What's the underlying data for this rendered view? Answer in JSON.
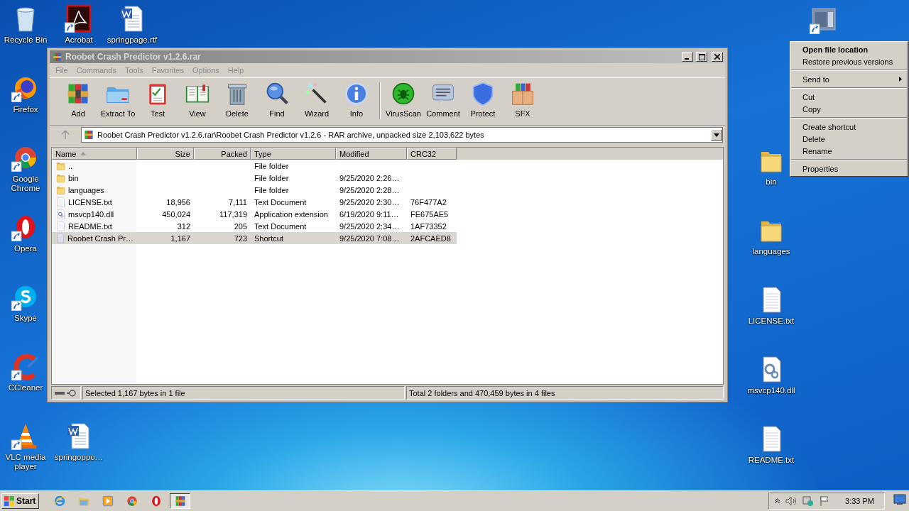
{
  "desktop_icons": [
    {
      "label": "Recycle Bin",
      "kind": "recycle",
      "shortcut": false
    },
    {
      "label": "Firefox",
      "kind": "firefox",
      "shortcut": true
    },
    {
      "label": "Google Chrome",
      "kind": "chrome",
      "shortcut": true
    },
    {
      "label": "Opera",
      "kind": "opera",
      "shortcut": true
    },
    {
      "label": "Skype",
      "kind": "skype",
      "shortcut": true
    },
    {
      "label": "CCleaner",
      "kind": "ccleaner",
      "shortcut": true
    },
    {
      "label": "VLC media player",
      "kind": "vlc",
      "shortcut": true
    },
    {
      "label": "Acrobat",
      "kind": "acrobat",
      "shortcut": true
    },
    {
      "label": "springpage.rtf",
      "kind": "word",
      "shortcut": false
    },
    {
      "label": "springoppo…",
      "kind": "word",
      "shortcut": false
    },
    {
      "kind": "appwindow",
      "shortcut": true
    },
    {
      "label": "bin",
      "kind": "folder",
      "shortcut": false
    },
    {
      "label": "languages",
      "kind": "folder",
      "shortcut": false
    },
    {
      "label": "LICENSE.txt",
      "kind": "text",
      "shortcut": false
    },
    {
      "label": "msvcp140.dll",
      "kind": "dll",
      "shortcut": false
    },
    {
      "label": "README.txt",
      "kind": "text",
      "shortcut": false
    }
  ],
  "window": {
    "title": "Roobet Crash Predictor v1.2.6.rar",
    "menu": [
      "File",
      "Commands",
      "Tools",
      "Favorites",
      "Options",
      "Help"
    ],
    "toolbar_groups": [
      [
        {
          "label": "Add",
          "kind": "add"
        },
        {
          "label": "Extract To",
          "kind": "extract"
        },
        {
          "label": "Test",
          "kind": "test"
        },
        {
          "label": "View",
          "kind": "view"
        },
        {
          "label": "Delete",
          "kind": "delete"
        },
        {
          "label": "Find",
          "kind": "find"
        },
        {
          "label": "Wizard",
          "kind": "wizard"
        },
        {
          "label": "Info",
          "kind": "info"
        }
      ],
      [
        {
          "label": "VirusScan",
          "kind": "virus"
        },
        {
          "label": "Comment",
          "kind": "comment"
        },
        {
          "label": "Protect",
          "kind": "protect"
        },
        {
          "label": "SFX",
          "kind": "sfx"
        }
      ]
    ],
    "address": "Roobet Crash Predictor v1.2.6.rar\\Roobet Crash Predictor v1.2.6 - RAR archive, unpacked size 2,103,622 bytes",
    "columns": [
      "Name",
      "Size",
      "Packed",
      "Type",
      "Modified",
      "CRC32"
    ],
    "files": [
      {
        "name": "..",
        "type": "File folder",
        "kind": "folder",
        "selected": false
      },
      {
        "name": "bin",
        "type": "File folder",
        "modified": "9/25/2020 2:26…",
        "kind": "folder",
        "selected": false
      },
      {
        "name": "languages",
        "type": "File folder",
        "modified": "9/25/2020 2:28…",
        "kind": "folder",
        "selected": false
      },
      {
        "name": "LICENSE.txt",
        "size": "18,956",
        "packed": "7,111",
        "type": "Text Document",
        "modified": "9/25/2020 2:30…",
        "crc32": "76F477A2",
        "kind": "text",
        "selected": false
      },
      {
        "name": "msvcp140.dll",
        "size": "450,024",
        "packed": "117,319",
        "type": "Application extension",
        "modified": "6/19/2020 9:11…",
        "crc32": "FE675AE5",
        "kind": "dll",
        "selected": false
      },
      {
        "name": "README.txt",
        "size": "312",
        "packed": "205",
        "type": "Text Document",
        "modified": "9/25/2020 2:34…",
        "crc32": "1AF73352",
        "kind": "text",
        "selected": false
      },
      {
        "name": "Roobet Crash Pr…",
        "size": "1,167",
        "packed": "723",
        "type": "Shortcut",
        "modified": "9/25/2020 7:08…",
        "crc32": "2AFCAED8",
        "kind": "shortcut",
        "selected": true
      }
    ],
    "status_left": "Selected 1,167 bytes in 1 file",
    "status_right": "Total 2 folders and 470,459 bytes in 4 files"
  },
  "context_menu": [
    [
      {
        "label": "Open file location",
        "default": true,
        "submenu": false
      },
      {
        "label": "Restore previous versions",
        "default": false,
        "submenu": false
      }
    ],
    [
      {
        "label": "Send to",
        "default": false,
        "submenu": true
      }
    ],
    [
      {
        "label": "Cut",
        "default": false,
        "submenu": false
      },
      {
        "label": "Copy",
        "default": false,
        "submenu": false
      }
    ],
    [
      {
        "label": "Create shortcut",
        "default": false,
        "submenu": false
      },
      {
        "label": "Delete",
        "default": false,
        "submenu": false
      },
      {
        "label": "Rename",
        "default": false,
        "submenu": false
      }
    ],
    [
      {
        "label": "Properties",
        "default": false,
        "submenu": false
      }
    ]
  ],
  "taskbar": {
    "start": "Start",
    "apps": [
      {
        "kind": "ie",
        "active": false
      },
      {
        "kind": "explorer",
        "active": false
      },
      {
        "kind": "media",
        "active": false
      },
      {
        "kind": "chrome",
        "active": false
      },
      {
        "kind": "opera",
        "active": false
      },
      {
        "kind": "winrar",
        "active": true
      }
    ],
    "clock": "3:33 PM"
  }
}
